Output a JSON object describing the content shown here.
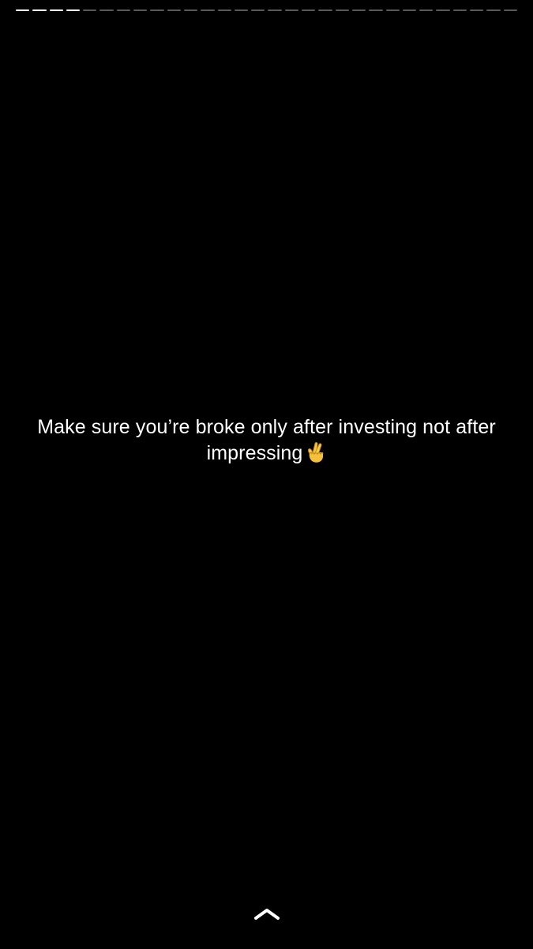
{
  "story": {
    "total_segments": 30,
    "viewed_segments": 4,
    "caption": "Make sure you’re broke only after investing not after impressing",
    "caption_emoji": "🤞"
  },
  "icons": {
    "caption_emoji_icon": "crossed-fingers-icon",
    "swipe_up": "chevron-up-icon"
  },
  "colors": {
    "background": "#000000",
    "text": "#ffffff",
    "progress_done": "#ffffff",
    "progress_pending": "#595959"
  }
}
